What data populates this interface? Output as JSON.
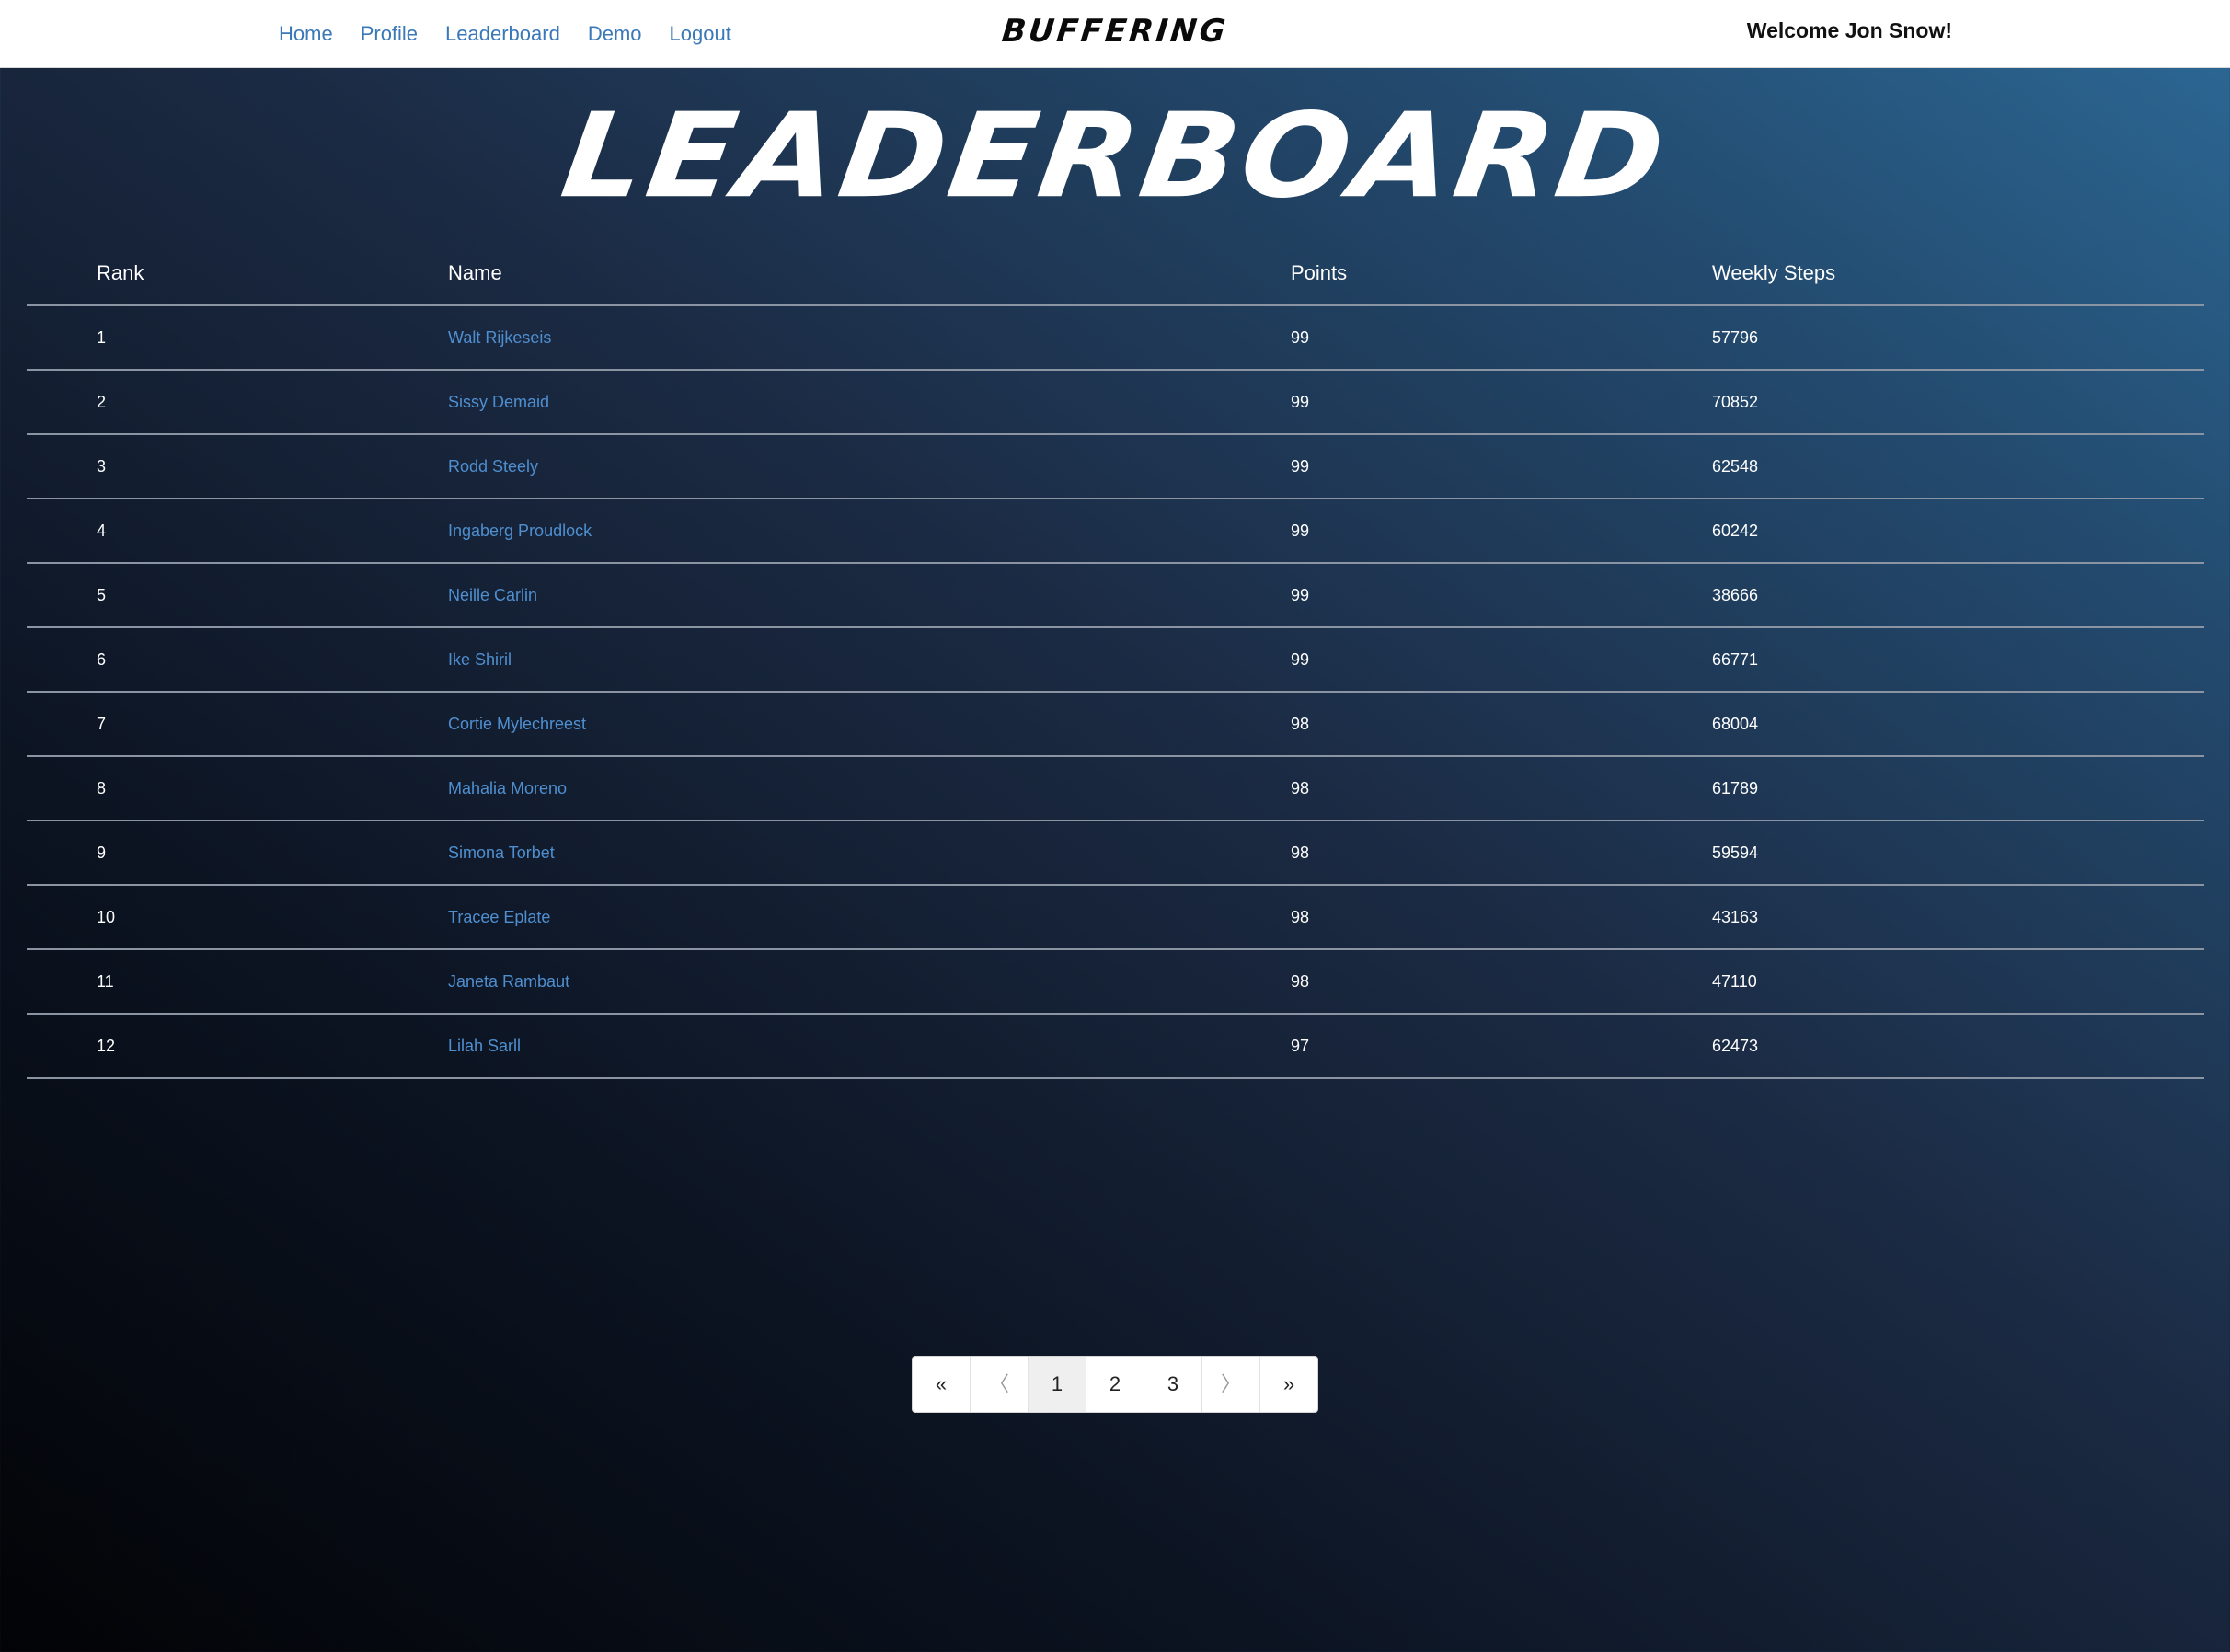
{
  "nav": {
    "links": [
      "Home",
      "Profile",
      "Leaderboard",
      "Demo",
      "Logout"
    ],
    "brand": "BUFFERING",
    "welcome": "Welcome Jon Snow!"
  },
  "page": {
    "title": "LEADERBOARD"
  },
  "table": {
    "headers": [
      "Rank",
      "Name",
      "Points",
      "Weekly Steps"
    ],
    "rows": [
      {
        "rank": "1",
        "name": "Walt Rijkeseis",
        "points": "99",
        "steps": "57796"
      },
      {
        "rank": "2",
        "name": "Sissy Demaid",
        "points": "99",
        "steps": "70852"
      },
      {
        "rank": "3",
        "name": "Rodd Steely",
        "points": "99",
        "steps": "62548"
      },
      {
        "rank": "4",
        "name": "Ingaberg Proudlock",
        "points": "99",
        "steps": "60242"
      },
      {
        "rank": "5",
        "name": "Neille Carlin",
        "points": "99",
        "steps": "38666"
      },
      {
        "rank": "6",
        "name": "Ike Shiril",
        "points": "99",
        "steps": "66771"
      },
      {
        "rank": "7",
        "name": "Cortie Mylechreest",
        "points": "98",
        "steps": "68004"
      },
      {
        "rank": "8",
        "name": "Mahalia Moreno",
        "points": "98",
        "steps": "61789"
      },
      {
        "rank": "9",
        "name": "Simona Torbet",
        "points": "98",
        "steps": "59594"
      },
      {
        "rank": "10",
        "name": "Tracee Eplate",
        "points": "98",
        "steps": "43163"
      },
      {
        "rank": "11",
        "name": "Janeta Rambaut",
        "points": "98",
        "steps": "47110"
      },
      {
        "rank": "12",
        "name": "Lilah Sarll",
        "points": "97",
        "steps": "62473"
      }
    ]
  },
  "pagination": {
    "first": "«",
    "prev": "〈",
    "pages": [
      "1",
      "2",
      "3"
    ],
    "active_page": "1",
    "next": "〉",
    "last": "»"
  },
  "colors": {
    "link": "#3a78b8",
    "name_link": "#4f8fd0",
    "background_dark": "#020306",
    "background_light": "#2c6996"
  }
}
